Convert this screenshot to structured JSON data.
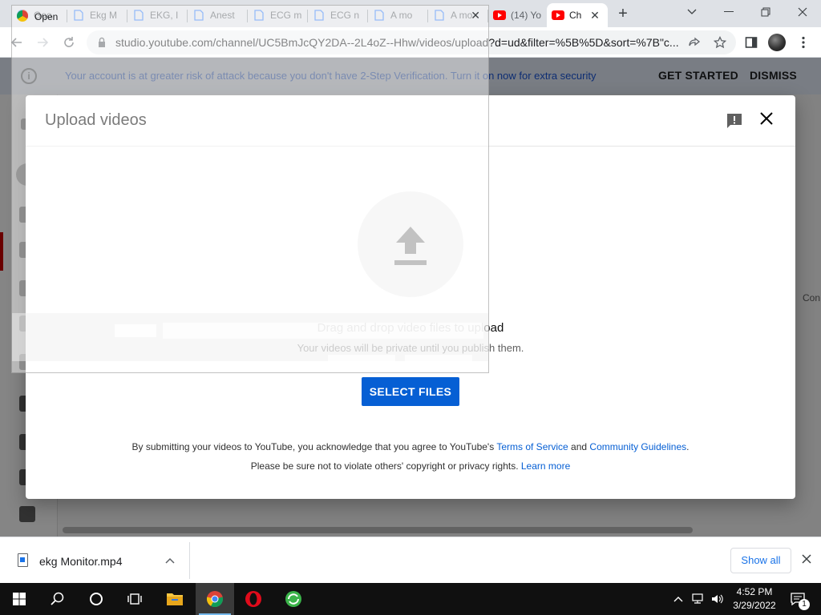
{
  "browser": {
    "tabs": [
      {
        "label": "Goo",
        "favicon": "google-icon"
      },
      {
        "label": "Ekg M",
        "favicon": "docs-icon"
      },
      {
        "label": "EKG, I",
        "favicon": "docs-icon"
      },
      {
        "label": "Anest",
        "favicon": "docs-icon"
      },
      {
        "label": "ECG m",
        "favicon": "docs-icon"
      },
      {
        "label": "ECG n",
        "favicon": "docs-icon"
      },
      {
        "label": "A mo",
        "favicon": "docs-icon"
      },
      {
        "label": "A mo",
        "favicon": "docs-icon"
      },
      {
        "label": "(14) Yo",
        "favicon": "youtube-icon"
      },
      {
        "label": "Ch",
        "favicon": "youtube-icon",
        "active": true
      }
    ],
    "url": "studio.youtube.com/channel/UC5BmJcQY2DA--2L4oZ--Hhw/videos/upload?d=ud&filter=%5B%5D&sort=%7B\"c..."
  },
  "open_dialog": {
    "title": "Open"
  },
  "notice": {
    "message": "Your account is at greater risk of attack because you don't have 2-Step Verification. Turn it on now for extra security",
    "get_started": "GET STARTED",
    "dismiss": "DISMISS"
  },
  "background_page": {
    "partial_text": "Con"
  },
  "upload_dialog": {
    "title": "Upload videos",
    "drag_text": "Drag and drop video files to upload",
    "private_text": "Your videos will be private until you publish them.",
    "select_button": "SELECT FILES",
    "terms_prefix": "By submitting your videos to YouTube, you acknowledge that you agree to YouTube's ",
    "terms_link": "Terms of Service",
    "terms_and": " and ",
    "guidelines_link": "Community Guidelines",
    "terms_suffix": ".",
    "rights_text": "Please be sure not to violate others' copyright or privacy rights. ",
    "learn_more": "Learn more"
  },
  "download_bar": {
    "filename": "ekg Monitor.mp4",
    "show_all": "Show all"
  },
  "taskbar": {
    "time": "4:52 PM",
    "date": "3/29/2022",
    "notification_count": "1"
  },
  "colors": {
    "accent": "#065fd4",
    "notice_bg": "#e8f0fe",
    "taskbar": "#101010"
  }
}
